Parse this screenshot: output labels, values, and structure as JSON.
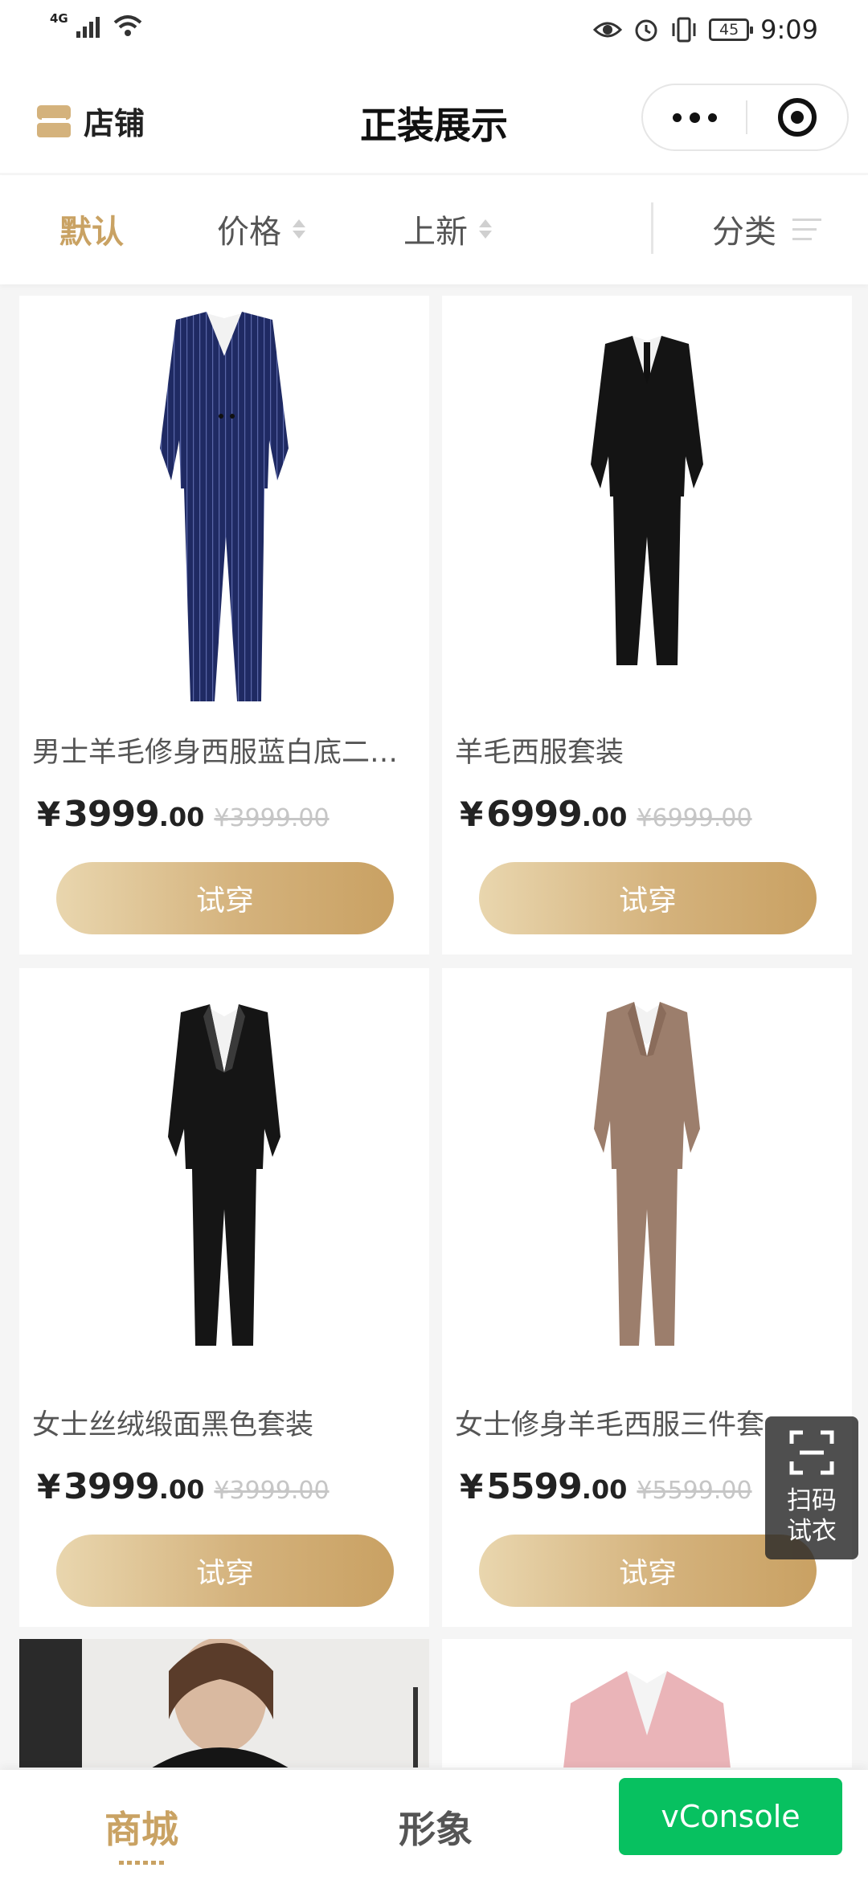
{
  "status_bar": {
    "network": "4G",
    "battery": "45",
    "time": "9:09"
  },
  "header": {
    "store_label": "店铺",
    "title": "正装展示"
  },
  "filters": {
    "default": "默认",
    "price": "价格",
    "new": "上新",
    "category": "分类",
    "active_color": "#c9a263"
  },
  "products": [
    {
      "name": "男士羊毛修身西服蓝白底二件套",
      "price_int": "3999",
      "price_dec": ".00",
      "original": "¥3999.00",
      "button": "试穿"
    },
    {
      "name": "羊毛西服套装",
      "price_int": "6999",
      "price_dec": ".00",
      "original": "¥6999.00",
      "button": "试穿"
    },
    {
      "name": "女士丝绒缎面黑色套装",
      "price_int": "3999",
      "price_dec": ".00",
      "original": "¥3999.00",
      "button": "试穿"
    },
    {
      "name": "女士修身羊毛西服三件套",
      "price_int": "5599",
      "price_dec": ".00",
      "original": "¥5599.00",
      "button": "试穿"
    }
  ],
  "currency_symbol": "¥",
  "scan_button": {
    "line1": "扫码",
    "line2": "试衣"
  },
  "tabbar": {
    "mall": "商城",
    "image": "形象"
  },
  "vconsole": "vConsole",
  "colors": {
    "gold": "#c9a263",
    "vconsole_green": "#07c160"
  }
}
